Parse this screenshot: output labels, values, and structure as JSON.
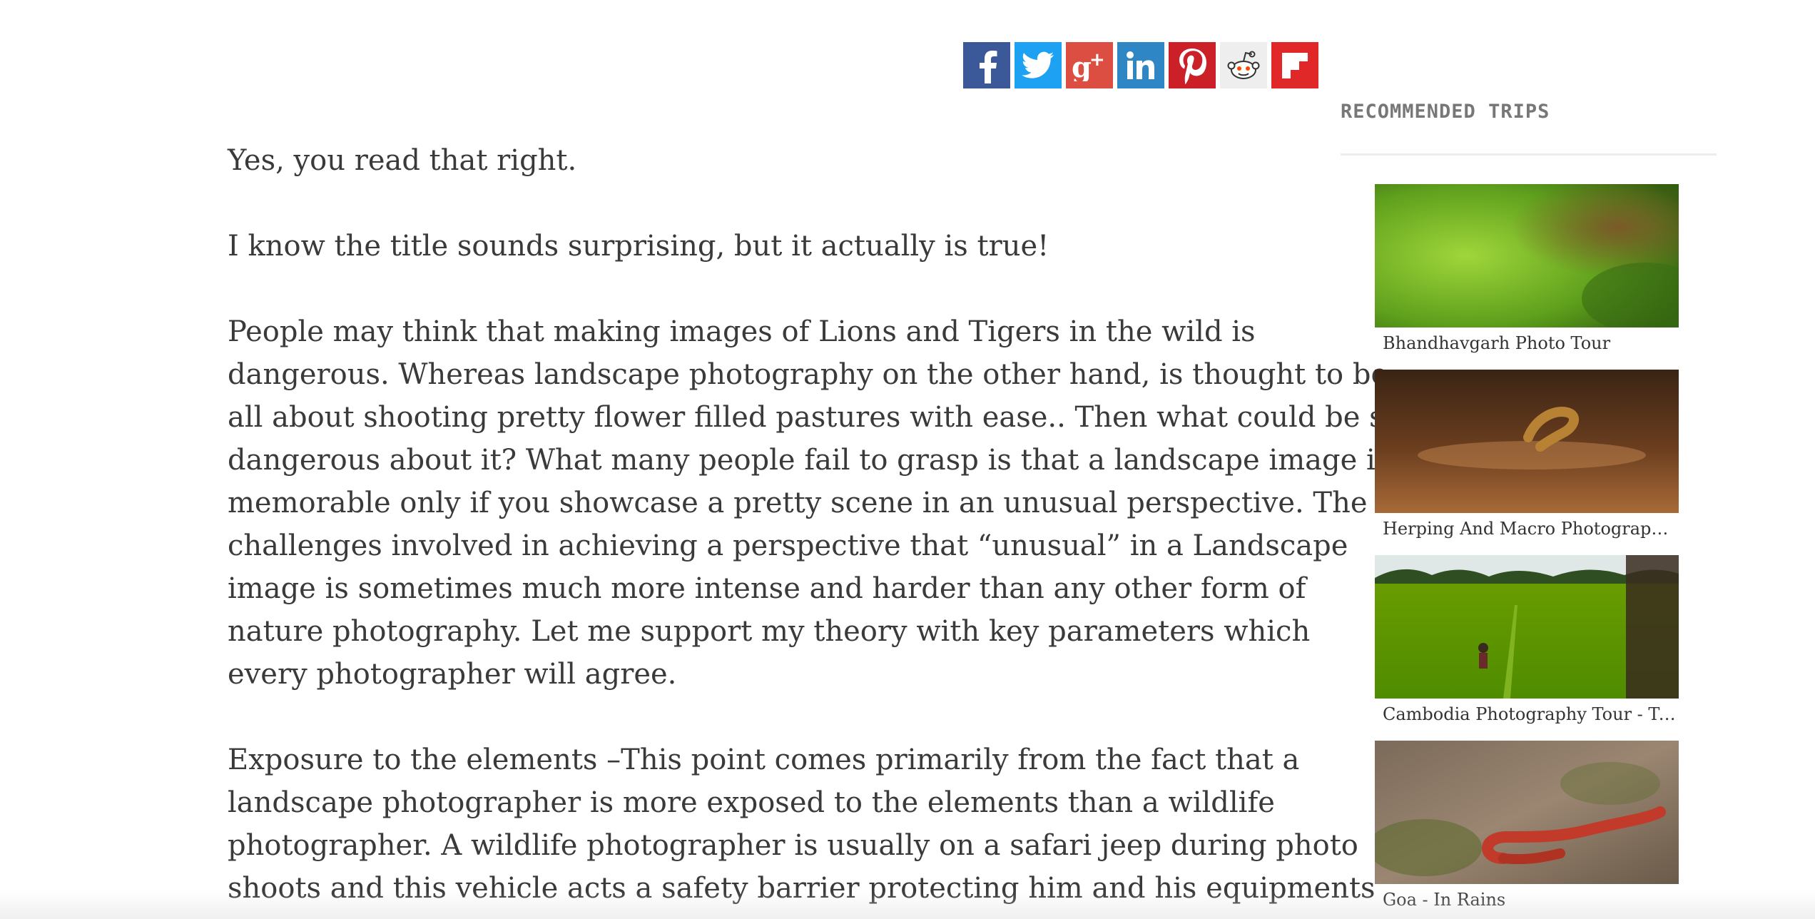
{
  "share": {
    "buttons": [
      {
        "network": "facebook",
        "icon": "facebook-icon",
        "color": "#3b5998"
      },
      {
        "network": "twitter",
        "icon": "twitter-icon",
        "color": "#1da1f2"
      },
      {
        "network": "google-plus",
        "icon": "google-plus-icon",
        "color": "#dc4e41"
      },
      {
        "network": "linkedin",
        "icon": "linkedin-icon",
        "color": "#0077b5"
      },
      {
        "network": "pinterest",
        "icon": "pinterest-icon",
        "color": "#cb2027"
      },
      {
        "network": "reddit",
        "icon": "reddit-icon",
        "color": "#eeeeee"
      },
      {
        "network": "flipboard",
        "icon": "flipboard-icon",
        "color": "#e12828"
      }
    ]
  },
  "article": {
    "p1": "Yes, you read that right.",
    "p2": "I know the title sounds surprising, but it actually is true!",
    "p3": [
      "People may think that making images of Lions and Tigers in the wild is",
      "dangerous. Whereas landscape photography on the other hand, is thought to be",
      "all about shooting pretty flower filled pastures with ease.. Then what could be so",
      "dangerous about it? What many people fail to grasp is that a landscape image is",
      "memorable only if you showcase a pretty scene in an unusual perspective. The",
      "challenges involved in achieving a perspective that “unusual” in a Landscape",
      "image is sometimes much more intense and harder than any other form of",
      "nature photography. Let me support my theory with key parameters which",
      "every photographer will agree."
    ],
    "p4": [
      "Exposure to the elements –This point comes primarily from the fact that a",
      "landscape photographer is more exposed to the elements than a wildlife",
      "photographer. A wildlife photographer is usually on a safari jeep during photo",
      "shoots and this vehicle acts a safety barrier protecting him and his equipments"
    ]
  },
  "sidebar": {
    "heading": "RECOMMENDED TRIPS",
    "trips": [
      {
        "title": "Bhandhavgarh Photo Tour"
      },
      {
        "title": "Herping And Macro Photography ..."
      },
      {
        "title": "Cambodia Photography Tour - Tem..."
      },
      {
        "title": "Goa - In Rains"
      }
    ]
  }
}
